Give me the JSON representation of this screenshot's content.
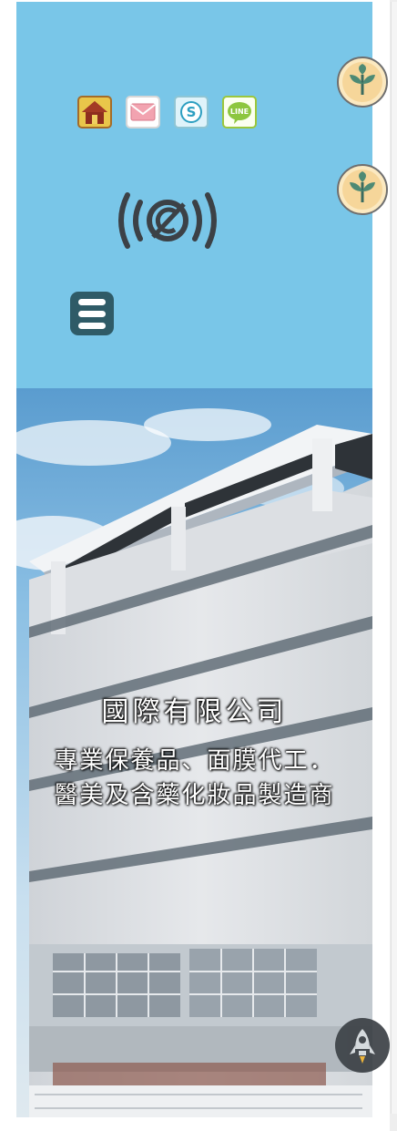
{
  "header": {
    "bg_color": "#79c6e8",
    "social_icons": [
      "home-icon",
      "mail-icon",
      "skype-icon",
      "line-icon"
    ],
    "social_labels": {
      "line": "LINE"
    },
    "menu_icon": "hamburger-icon",
    "status_icon": "broadcast-no-copyright-icon"
  },
  "hero": {
    "title": "國際有限公司",
    "line1": "專業保養品、面膜代工．",
    "line2": "醫美及含藥化妝品製造商"
  },
  "floating": {
    "buttons": [
      "leaf-icon",
      "leaf-icon"
    ],
    "back_to_top_icon": "rocket-icon"
  }
}
